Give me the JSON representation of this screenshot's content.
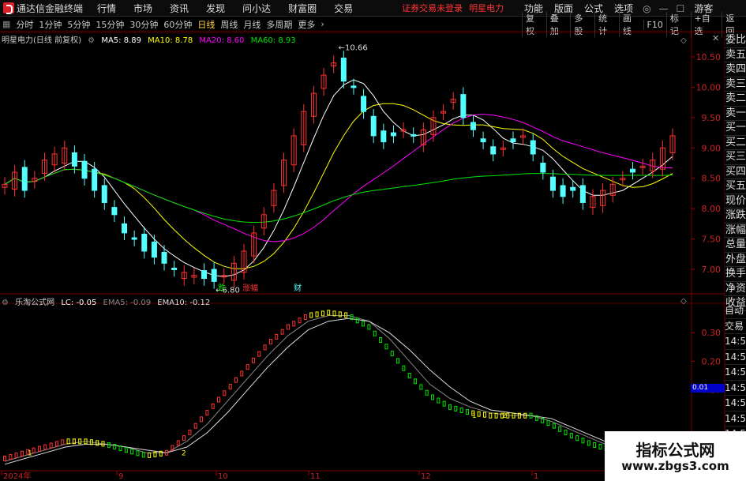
{
  "menubar": {
    "title": "通达信金融终端",
    "items": [
      "行情",
      "市场",
      "资讯",
      "发现",
      "问小达",
      "财富圈",
      "交易"
    ],
    "warning": "证券交易未登录",
    "stock": "明星电力",
    "right": [
      "功能",
      "版面",
      "公式",
      "选项"
    ],
    "guest": "游客"
  },
  "toolbar": {
    "periods": [
      "分时",
      "1分钟",
      "5分钟",
      "15分钟",
      "30分钟",
      "60分钟",
      "日线",
      "周线",
      "月线",
      "多周期",
      "更多"
    ],
    "selected": "日线",
    "right": [
      "复权",
      "叠加",
      "多股",
      "统计",
      "画线",
      "F10",
      "标记",
      "+自选",
      "返回"
    ]
  },
  "legend": {
    "name": "明星电力(日线 前复权)",
    "ma5": "MA5: 8.89",
    "ma10": "MA10: 8.78",
    "ma20": "MA20: 8.60",
    "ma60": "MA60: 8.93"
  },
  "sub_legend": {
    "name": "乐淘公式网",
    "lc": "LC: -0.05",
    "ema5": "EMA5: -0.09",
    "ema10": "EMA10: -0.12"
  },
  "price_axis": [
    "10.50",
    "10.00",
    "9.50",
    "9.00",
    "8.50",
    "8.00",
    "7.50",
    "7.00"
  ],
  "sub_axis": [
    "0.30",
    "0.20",
    "0.10",
    "0.01",
    "-0.10"
  ],
  "sub_current": "0.01",
  "annotations": {
    "high": "10.66",
    "low": "6.80",
    "drop": "跌",
    "rise": "涨幅",
    "finance": "财"
  },
  "x_axis": [
    "2024年",
    "9",
    "10",
    "11",
    "12",
    "1"
  ],
  "sidebar": [
    "委比",
    "卖五",
    "卖四",
    "卖三",
    "卖二",
    "卖一",
    "买一",
    "买二",
    "买三",
    "买四",
    "买五",
    "现价",
    "涨跌",
    "涨幅",
    "总量",
    "外盘",
    "换手",
    "净资",
    "收益"
  ],
  "sidebar2": [
    "自动",
    "交易",
    "14:56",
    "14:56",
    "14:56",
    "14:56",
    "14:56",
    "14:56",
    "14:56",
    "14:56"
  ],
  "watermark": {
    "line1": "指标公式网",
    "line2": "www.zbgs3.com"
  },
  "colors": {
    "up": "#ff3232",
    "down": "#54ffff",
    "ma5": "#ffffff",
    "ma10": "#ffff00",
    "ma20": "#ff00ff",
    "ma60": "#00e600"
  },
  "chart_data": {
    "type": "candlestick",
    "title": "明星电力(日线 前复权)",
    "ylim": [
      6.7,
      10.8
    ],
    "candles_approx_close": [
      8.4,
      8.6,
      8.3,
      8.5,
      8.8,
      8.9,
      9.0,
      8.7,
      8.5,
      8.3,
      8.1,
      7.9,
      7.6,
      7.5,
      7.3,
      7.2,
      7.1,
      7.0,
      6.95,
      6.9,
      6.85,
      6.8,
      6.9,
      7.1,
      7.3,
      7.6,
      7.9,
      8.3,
      8.8,
      9.2,
      9.6,
      9.9,
      10.2,
      10.4,
      10.1,
      10.0,
      9.6,
      9.2,
      9.1,
      9.2,
      9.3,
      9.2,
      9.3,
      9.5,
      9.6,
      9.8,
      9.5,
      9.3,
      9.1,
      8.9,
      9.0,
      9.1,
      9.2,
      8.9,
      8.6,
      8.3,
      8.2,
      8.3,
      8.1,
      8.2,
      8.3,
      8.4,
      8.5,
      8.6,
      8.7,
      8.8,
      9.0,
      9.2
    ]
  },
  "sub_chart_data": {
    "type": "line",
    "series": [
      {
        "name": "LC",
        "values": [
          -0.14,
          -0.12,
          -0.1,
          -0.08,
          -0.08,
          -0.09,
          -0.11,
          -0.13,
          -0.12,
          -0.06,
          0.02,
          0.1,
          0.18,
          0.26,
          0.32,
          0.36,
          0.37,
          0.36,
          0.32,
          0.24,
          0.15,
          0.08,
          0.04,
          0.02,
          0.01,
          0.01,
          0.01,
          -0.02,
          -0.06,
          -0.09,
          -0.11,
          -0.1,
          -0.08,
          -0.05
        ]
      },
      {
        "name": "EMA5",
        "values": [
          -0.15,
          -0.13,
          -0.11,
          -0.09,
          -0.08,
          -0.09,
          -0.1,
          -0.12,
          -0.12,
          -0.08,
          -0.02,
          0.06,
          0.14,
          0.22,
          0.29,
          0.34,
          0.36,
          0.36,
          0.34,
          0.28,
          0.2,
          0.12,
          0.07,
          0.04,
          0.02,
          0.01,
          0.01,
          -0.01,
          -0.04,
          -0.07,
          -0.1,
          -0.1,
          -0.09,
          -0.09
        ]
      },
      {
        "name": "EMA10",
        "values": [
          -0.16,
          -0.14,
          -0.12,
          -0.1,
          -0.09,
          -0.09,
          -0.1,
          -0.11,
          -0.12,
          -0.1,
          -0.05,
          0.02,
          0.1,
          0.18,
          0.25,
          0.31,
          0.34,
          0.35,
          0.34,
          0.3,
          0.24,
          0.17,
          0.11,
          0.06,
          0.03,
          0.02,
          0.01,
          0.0,
          -0.03,
          -0.06,
          -0.09,
          -0.1,
          -0.11,
          -0.12
        ]
      }
    ],
    "ylim": [
      -0.18,
      0.4
    ]
  }
}
